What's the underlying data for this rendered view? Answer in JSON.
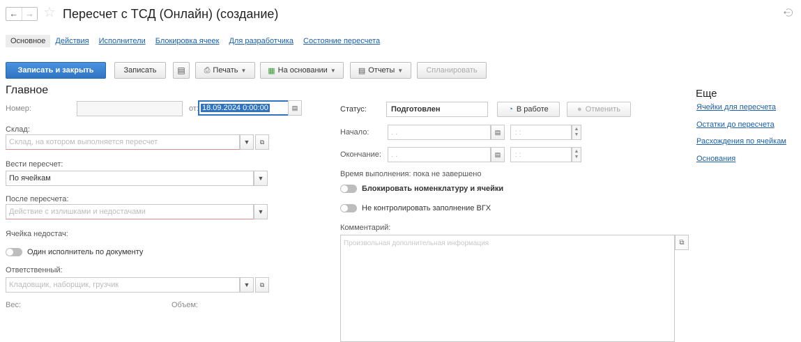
{
  "window": {
    "title": "Пересчет с ТСД (Онлайн) (создание)"
  },
  "tabs": [
    {
      "label": "Основное"
    },
    {
      "label": "Действия"
    },
    {
      "label": "Исполнители"
    },
    {
      "label": "Блокировка ячеек"
    },
    {
      "label": "Для разработчика"
    },
    {
      "label": "Состояние пересчета"
    }
  ],
  "toolbar": {
    "save_close": "Записать и закрыть",
    "save": "Записать",
    "print": "Печать",
    "based_on": "На основании",
    "reports": "Отчеты",
    "plan": "Спланировать"
  },
  "main": {
    "heading": "Главное",
    "number_label": "Номер:",
    "number_value": "",
    "from_label": "от:",
    "date_value": "18.09.2024  0:00:00",
    "warehouse_label": "Склад:",
    "warehouse_placeholder": "Склад, на котором выполняется пересчет",
    "mode_label": "Вести пересчет:",
    "mode_value": "По ячейкам",
    "after_label": "После пересчета:",
    "after_placeholder": "Действие с излишками и недостачами",
    "shortage_label": "Ячейка недостач:",
    "single_executor_label": "Один исполнитель по документу",
    "responsible_label": "Ответственный:",
    "responsible_placeholder": "Кладовщик, наборщик, грузчик",
    "weight_label": "Вес:",
    "volume_label": "Объем:"
  },
  "status": {
    "label": "Статус:",
    "value": "Подготовлен",
    "in_work_button": "В работе",
    "cancel_button": "Отменить",
    "start_label": "Начало:",
    "start_date_placeholder": ". .",
    "start_time_placeholder": ": :",
    "end_label": "Окончание:",
    "end_date_placeholder": ". .",
    "end_time_placeholder": ": :",
    "exec_time": "Время выполнения: пока не завершено",
    "block_label": "Блокировать номенклатуру и ячейки",
    "no_control_label": "Не контролировать заполнение ВГХ",
    "comment_label": "Комментарий:",
    "comment_placeholder": "Произвольная дополнительная информация"
  },
  "side": {
    "heading": "Еще",
    "links": [
      {
        "label": "Ячейки для пересчета"
      },
      {
        "label": "Остатки до пересчета"
      },
      {
        "label": "Расхождения по ячейкам"
      },
      {
        "label": "Основания"
      }
    ]
  },
  "colors": {
    "accent": "#2f74c3",
    "link": "#1a5fa8",
    "required_underline": "#e08b8b"
  }
}
